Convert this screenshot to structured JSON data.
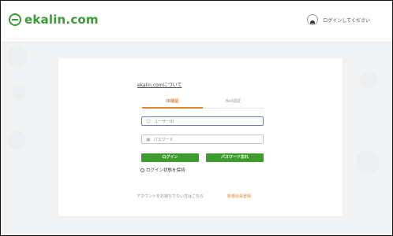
{
  "header": {
    "logo_text": "ekalin.com",
    "login_link": "ログインしてください"
  },
  "card": {
    "about_link": "ekalin.comについて",
    "tabs": [
      {
        "label": "ID認証",
        "active": true
      },
      {
        "label": "Bell認証",
        "active": false
      }
    ],
    "user_placeholder": "ユーザーID",
    "password_placeholder": "パスワード",
    "login_button": "ログイン",
    "forgot_button": "パスワード忘れ",
    "remember_label": "ログイン状態を保持",
    "signup_question": "アカウントをお持ちでない方はこちら",
    "signup_link": "新規会員登録"
  },
  "colors": {
    "brand_green": "#3a9b35",
    "button_green": "#3e9b2e",
    "accent_orange": "#e08a2e"
  }
}
